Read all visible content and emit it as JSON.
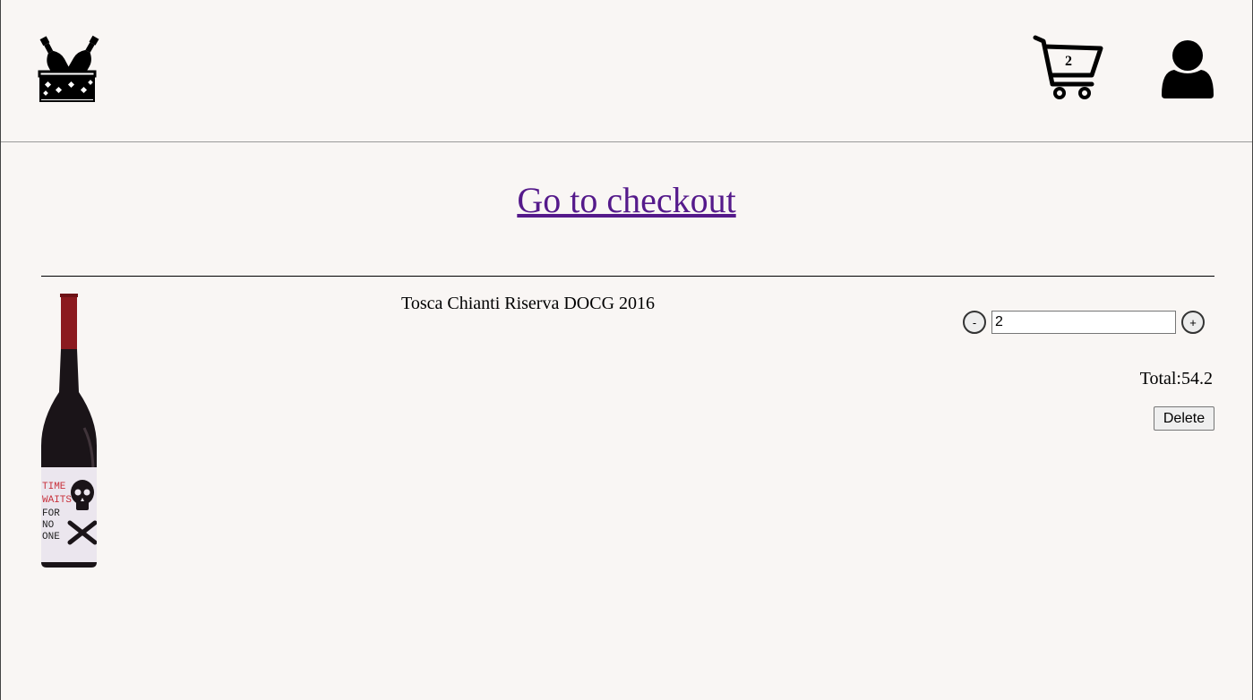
{
  "header": {
    "logo_icon": "wine-bucket-icon",
    "cart_icon": "shopping-cart-icon",
    "cart_count": "2",
    "user_icon": "user-icon"
  },
  "main": {
    "checkout_link_label": "Go to checkout",
    "cart_item": {
      "image_icon": "wine-bottle-image",
      "name": "Tosca Chianti Riserva DOCG 2016",
      "decrease_label": "-",
      "quantity_value": "2",
      "increase_label": "+",
      "total_label": "Total:",
      "total_value": "54.2",
      "delete_label": "Delete",
      "label_lines": [
        "TIME",
        "WAITS",
        "FOR",
        "NO",
        "ONE"
      ]
    }
  },
  "colors": {
    "background": "#f9f6f4",
    "link": "#551a8b",
    "bottle_capsule": "#8b1a1f",
    "label_accent": "#c8323c"
  }
}
